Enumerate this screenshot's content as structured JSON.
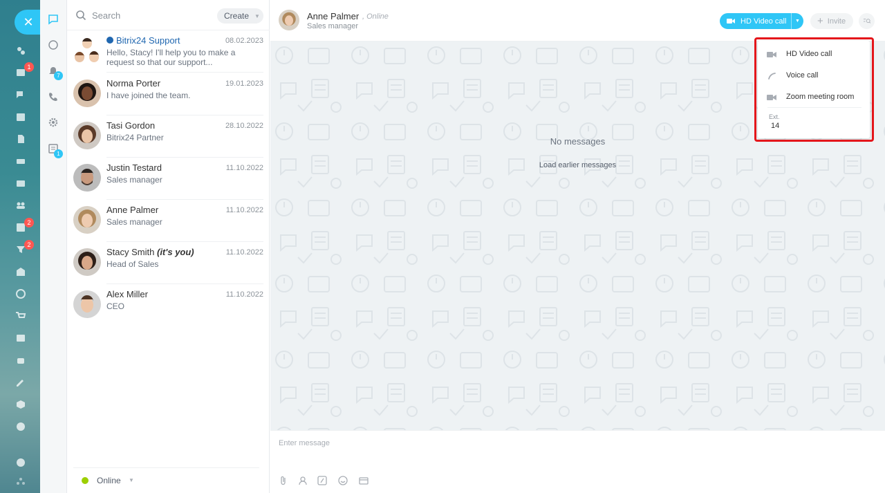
{
  "app_rail": {
    "badges": [
      "1",
      "2",
      "2"
    ]
  },
  "messenger_nav": {
    "badges": [
      "7",
      "1"
    ]
  },
  "recent": {
    "search_placeholder": "Search",
    "create_label": "Create",
    "items": [
      {
        "name": "Bitrix24 Support",
        "date": "08.02.2023",
        "subtitle": "Hello, Stacy! I'll help you to make a request so that our support..."
      },
      {
        "name": "Norma Porter",
        "date": "19.01.2023",
        "subtitle": "I have joined the team."
      },
      {
        "name": "Tasi Gordon",
        "date": "28.10.2022",
        "subtitle": "Bitrix24 Partner"
      },
      {
        "name": "Justin Testard",
        "date": "11.10.2022",
        "subtitle": "Sales manager"
      },
      {
        "name": "Anne Palmer",
        "date": "11.10.2022",
        "subtitle": "Sales manager"
      },
      {
        "name": "Stacy Smith",
        "name_suffix": "(it's you)",
        "date": "11.10.2022",
        "subtitle": "Head of Sales"
      },
      {
        "name": "Alex Miller",
        "date": "11.10.2022",
        "subtitle": "CEO"
      }
    ],
    "status": "Online"
  },
  "chat": {
    "name": "Anne Palmer",
    "status": ", Online",
    "position": "Sales manager",
    "video_call_label": "HD Video call",
    "invite_label": "Invite",
    "no_messages": "No messages",
    "load_earlier": "Load earlier messages",
    "composer_placeholder": "Enter message"
  },
  "call_menu": {
    "items": [
      "HD Video call",
      "Voice call",
      "Zoom meeting room"
    ],
    "ext_label": "Ext.",
    "ext_value": "14"
  },
  "colors": {
    "accent": "#2fc6f6",
    "highlight": "#e4161b",
    "online": "#9dcf00",
    "badge_red": "#ff5752"
  }
}
